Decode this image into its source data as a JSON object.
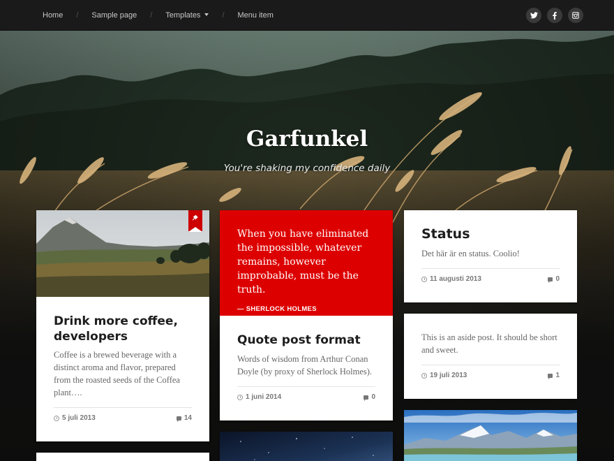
{
  "nav": {
    "items": [
      {
        "label": "Home"
      },
      {
        "label": "Sample page"
      },
      {
        "label": "Templates"
      },
      {
        "label": "Menu item"
      }
    ],
    "separator": "/"
  },
  "social": [
    "twitter-icon",
    "facebook-icon",
    "instagram-icon"
  ],
  "site": {
    "title": "Garfunkel",
    "description": "You're shaking my confidence daily"
  },
  "posts": {
    "coffee": {
      "title": "Drink more coffee, developers",
      "excerpt": "Coffee is a brewed beverage with a distinct aroma and flavor, prepared from the roasted seeds of the Coffea plant….",
      "date": "5 juli 2013",
      "comments": "14",
      "sticky": true
    },
    "quote": {
      "quote_text": "When you have eliminated the impossible, whatever remains, however improbable, must be the truth.",
      "quote_cite": "— SHERLOCK HOLMES",
      "title": "Quote post format",
      "excerpt": "Words of wisdom from Arthur Conan Doyle (by proxy of Sherlock Holmes).",
      "date": "1 juni 2014",
      "comments": "0"
    },
    "status": {
      "title": "Status",
      "excerpt": "Det här är en status. Coolio!",
      "date": "11 augusti 2013",
      "comments": "0"
    },
    "aside": {
      "excerpt": "This is an aside post. It should be short and sweet.",
      "date": "19 juli 2013",
      "comments": "1"
    }
  },
  "colors": {
    "accent": "#dd0000",
    "topbar": "#1a1a1a",
    "body": "#1d1d1d"
  }
}
